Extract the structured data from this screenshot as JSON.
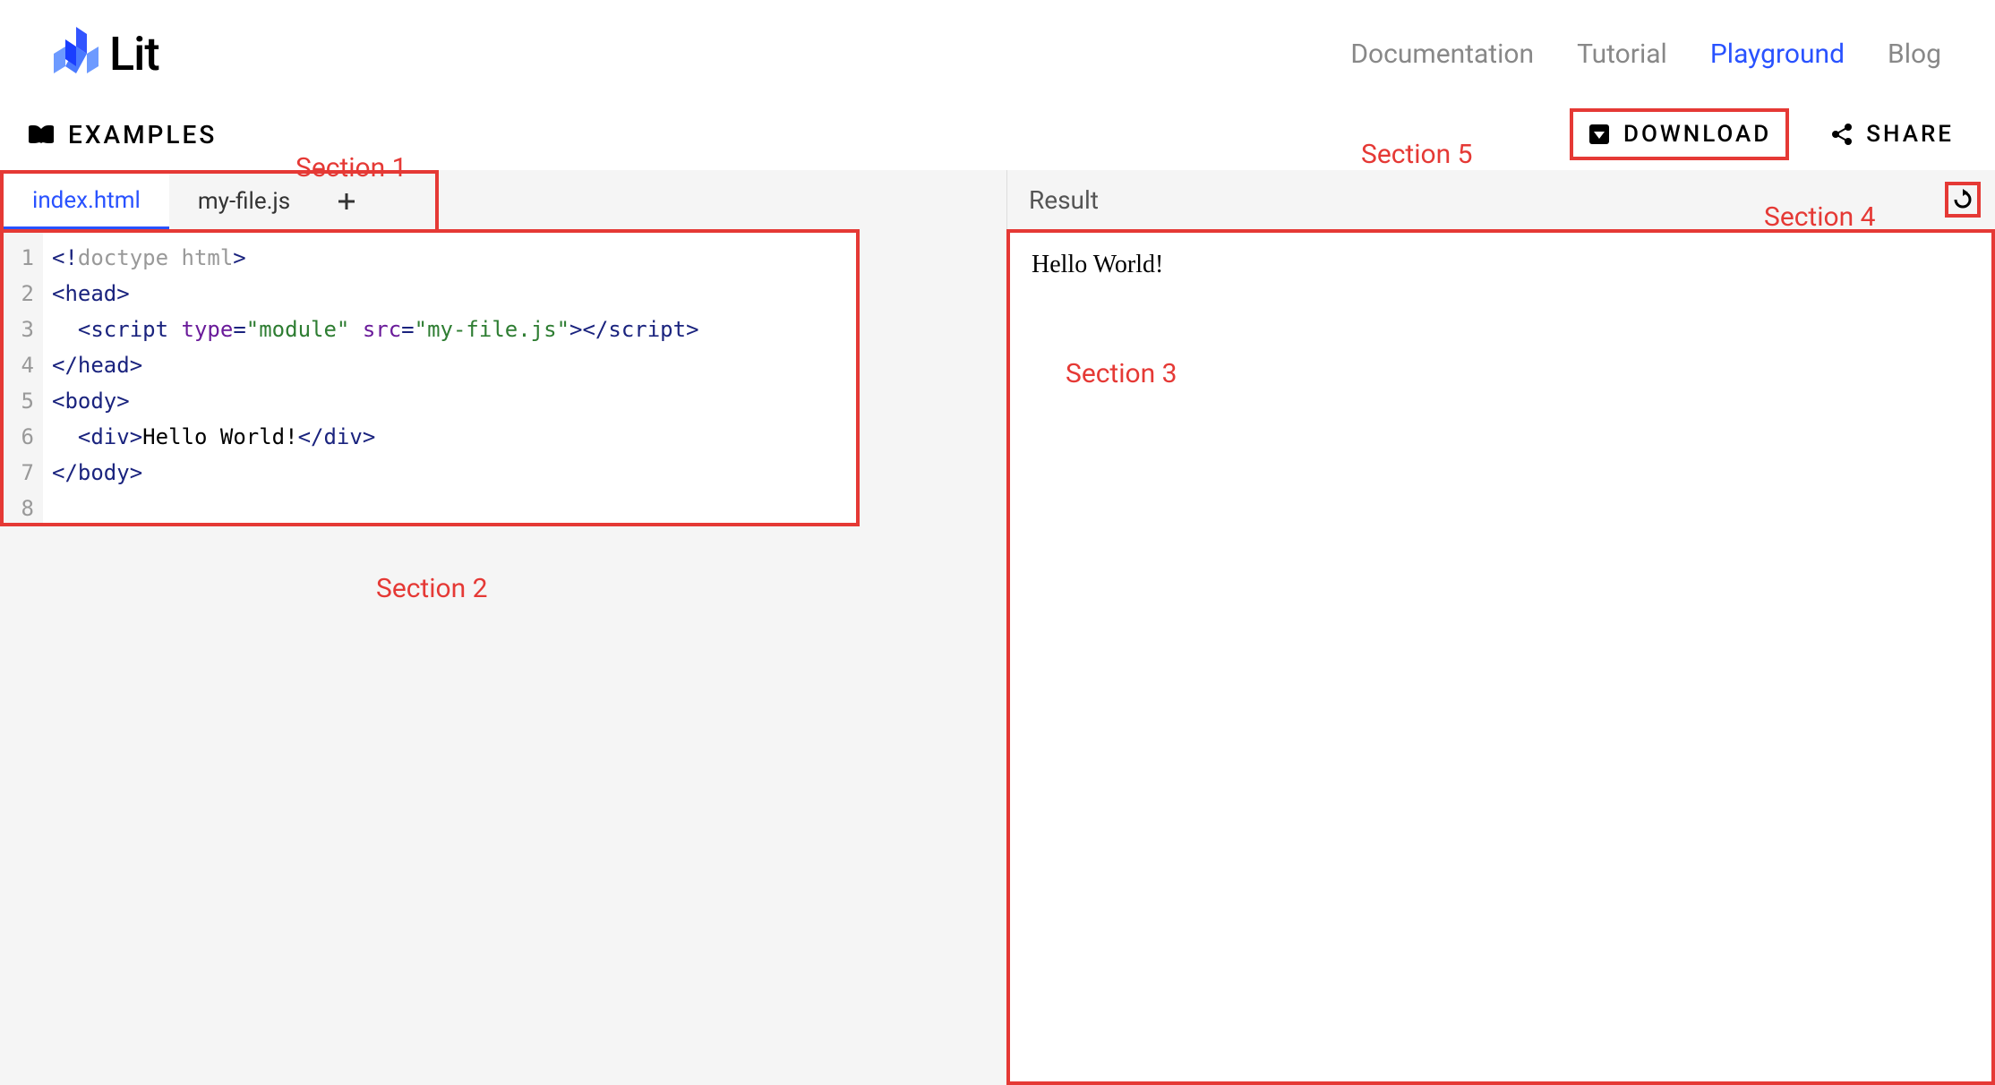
{
  "header": {
    "logo_text": "Lit",
    "nav": [
      {
        "label": "Documentation",
        "active": false
      },
      {
        "label": "Tutorial",
        "active": false
      },
      {
        "label": "Playground",
        "active": true
      },
      {
        "label": "Blog",
        "active": false
      }
    ]
  },
  "toolbar": {
    "examples_label": "EXAMPLES",
    "download_label": "DOWNLOAD",
    "share_label": "SHARE"
  },
  "tabs": [
    {
      "label": "index.html",
      "active": true
    },
    {
      "label": "my-file.js",
      "active": false
    }
  ],
  "editor": {
    "line_numbers": [
      "1",
      "2",
      "3",
      "4",
      "5",
      "6",
      "7",
      "8"
    ],
    "code_lines": [
      [
        {
          "t": "punc",
          "v": "<!"
        },
        {
          "t": "doctype",
          "v": "doctype html"
        },
        {
          "t": "punc",
          "v": ">"
        }
      ],
      [
        {
          "t": "punc",
          "v": "<"
        },
        {
          "t": "tag",
          "v": "head"
        },
        {
          "t": "punc",
          "v": ">"
        }
      ],
      [
        {
          "t": "text",
          "v": "  "
        },
        {
          "t": "punc",
          "v": "<"
        },
        {
          "t": "tag",
          "v": "script"
        },
        {
          "t": "text",
          "v": " "
        },
        {
          "t": "attr",
          "v": "type"
        },
        {
          "t": "punc",
          "v": "="
        },
        {
          "t": "string",
          "v": "\"module\""
        },
        {
          "t": "text",
          "v": " "
        },
        {
          "t": "attr",
          "v": "src"
        },
        {
          "t": "punc",
          "v": "="
        },
        {
          "t": "string",
          "v": "\"my-file.js\""
        },
        {
          "t": "punc",
          "v": "></"
        },
        {
          "t": "tag",
          "v": "script"
        },
        {
          "t": "punc",
          "v": ">"
        }
      ],
      [
        {
          "t": "punc",
          "v": "</"
        },
        {
          "t": "tag",
          "v": "head"
        },
        {
          "t": "punc",
          "v": ">"
        }
      ],
      [
        {
          "t": "punc",
          "v": "<"
        },
        {
          "t": "tag",
          "v": "body"
        },
        {
          "t": "punc",
          "v": ">"
        }
      ],
      [
        {
          "t": "text",
          "v": "  "
        },
        {
          "t": "punc",
          "v": "<"
        },
        {
          "t": "tag",
          "v": "div"
        },
        {
          "t": "punc",
          "v": ">"
        },
        {
          "t": "text",
          "v": "Hello World!"
        },
        {
          "t": "punc",
          "v": "</"
        },
        {
          "t": "tag",
          "v": "div"
        },
        {
          "t": "punc",
          "v": ">"
        }
      ],
      [
        {
          "t": "punc",
          "v": "</"
        },
        {
          "t": "tag",
          "v": "body"
        },
        {
          "t": "punc",
          "v": ">"
        }
      ],
      []
    ]
  },
  "result": {
    "title": "Result",
    "output": "Hello World!"
  },
  "annotations": {
    "section1": "Section 1",
    "section2": "Section 2",
    "section3": "Section 3",
    "section4": "Section 4",
    "section5": "Section 5"
  }
}
